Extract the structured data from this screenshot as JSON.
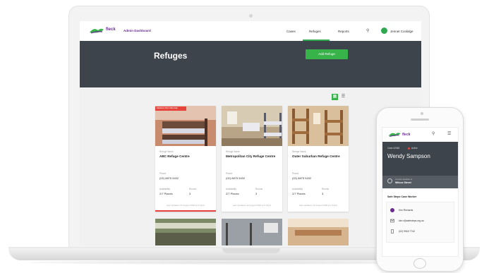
{
  "app": {
    "logo_text": "fleck",
    "admin_label": "Admin Dashboard"
  },
  "nav": {
    "links": [
      "Cases",
      "Refuges",
      "Reports"
    ],
    "active": "Refuges",
    "user_name": "Jennet Coolidge"
  },
  "page": {
    "title": "Refuges",
    "add_button": "Add Refuge"
  },
  "cards": [
    {
      "ribbon": "FEMALE ONLY REFUGE",
      "name_label": "Refuge Name",
      "name": "ABC Refuge Centre",
      "phone_label": "Phone",
      "phone": "(02) 8875 5432",
      "avail_label": "Availability",
      "avail": "2/7 Places",
      "rooms_label": "Rooms",
      "rooms": "3",
      "updated": "Last Updated: 22 August 2018 at 2:13pm"
    },
    {
      "ribbon": "",
      "name_label": "Refuge Name",
      "name": "Metropolitan City Refuge Centre",
      "phone_label": "Phone",
      "phone": "(02) 8875 5432",
      "avail_label": "Availability",
      "avail": "2/7 Places",
      "rooms_label": "Rooms",
      "rooms": "3",
      "updated": "Last Updated: 22 August 2018 at 2:13pm"
    },
    {
      "ribbon": "",
      "name_label": "Refuge Name",
      "name": "Outer Suburban Refuge Centre",
      "phone_label": "Phone",
      "phone": "(02) 8875 5432",
      "avail_label": "Availability",
      "avail": "2/7 Places",
      "rooms_label": "Rooms",
      "rooms": "3",
      "updated": "Last Updated: 22 August 2018 at 2:13pm"
    }
  ],
  "phone": {
    "case_id": "Case #2048",
    "status": "Active",
    "client_name": "Wendy Sampson",
    "location_label": "Current location is",
    "location": "Wilcox Street",
    "section_title": "Safe Steps Case Worker",
    "worker_name": "Kim Richards",
    "worker_email": "kim.r@safesteps.org.au",
    "worker_phone": "(02) 9918 7742"
  },
  "colors": {
    "accent": "#37b34a",
    "brand": "#6a2c91",
    "alert": "#e6433c",
    "hero": "#3d444c"
  },
  "icons": [
    "search-icon",
    "user-avatar",
    "grid-view-icon",
    "list-view-icon",
    "menu-icon",
    "location-pin-icon",
    "mail-icon",
    "phone-icon"
  ]
}
